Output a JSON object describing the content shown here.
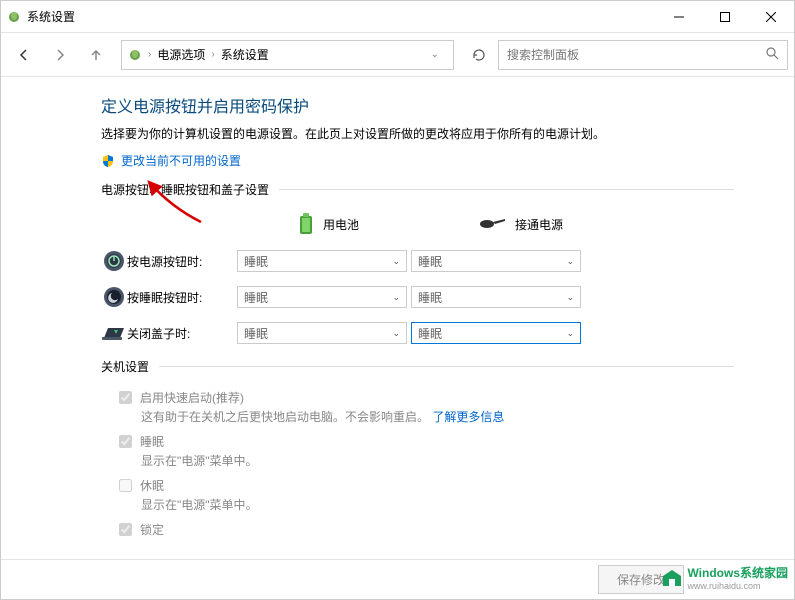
{
  "window": {
    "title": "系统设置"
  },
  "breadcrumb": {
    "item1": "电源选项",
    "item2": "系统设置"
  },
  "search": {
    "placeholder": "搜索控制面板"
  },
  "page": {
    "heading": "定义电源按钮并启用密码保护",
    "subtitle": "选择要为你的计算机设置的电源设置。在此页上对设置所做的更改将应用于你所有的电源计划。",
    "change_link": "更改当前不可用的设置",
    "section_buttons": "电源按钮、睡眠按钮和盖子设置",
    "col_battery": "用电池",
    "col_plugged": "接通电源",
    "row_power_label": "按电源按钮时:",
    "row_sleep_label": "按睡眠按钮时:",
    "row_lid_label": "关闭盖子时:",
    "power_battery": "睡眠",
    "power_plugged": "睡眠",
    "sleep_battery": "睡眠",
    "sleep_plugged": "睡眠",
    "lid_battery": "睡眠",
    "lid_plugged": "睡眠",
    "section_shutdown": "关机设置",
    "fast_startup": "启用快速启动(推荐)",
    "fast_startup_desc": "这有助于在关机之后更快地启动电脑。不会影响重启。",
    "learn_more": "了解更多信息",
    "sleep_opt": "睡眠",
    "sleep_opt_desc": "显示在\"电源\"菜单中。",
    "hibernate_opt": "休眠",
    "hibernate_opt_desc": "显示在\"电源\"菜单中。",
    "lock_opt": "锁定"
  },
  "footer": {
    "save": "保存修改"
  },
  "watermark": {
    "text": "Windows系统家园",
    "url": "www.ruihaidu.com"
  }
}
